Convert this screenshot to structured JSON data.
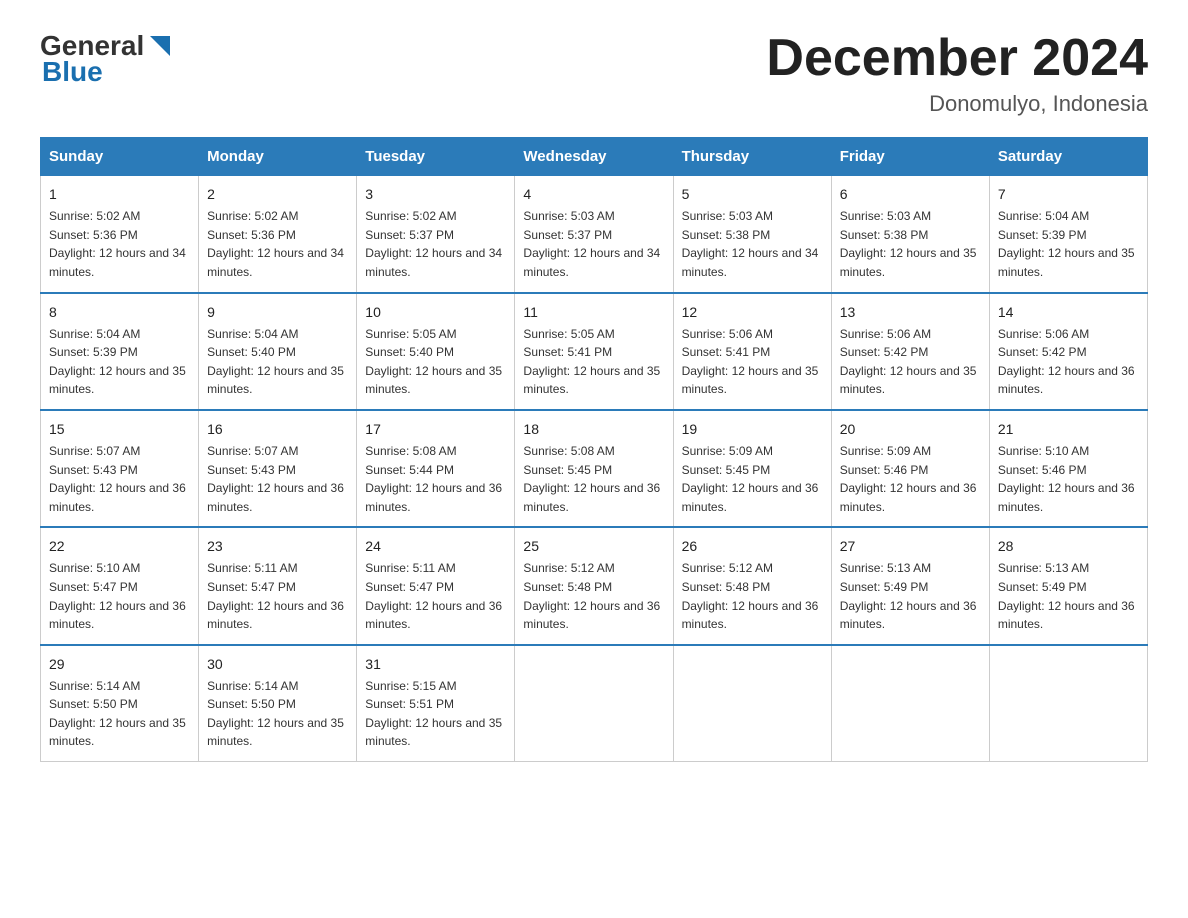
{
  "logo": {
    "general": "General",
    "blue": "Blue",
    "triangle_color": "#1a6faf"
  },
  "title": "December 2024",
  "subtitle": "Donomulyo, Indonesia",
  "days_of_week": [
    "Sunday",
    "Monday",
    "Tuesday",
    "Wednesday",
    "Thursday",
    "Friday",
    "Saturday"
  ],
  "weeks": [
    [
      {
        "num": "1",
        "sunrise": "5:02 AM",
        "sunset": "5:36 PM",
        "daylight": "12 hours and 34 minutes."
      },
      {
        "num": "2",
        "sunrise": "5:02 AM",
        "sunset": "5:36 PM",
        "daylight": "12 hours and 34 minutes."
      },
      {
        "num": "3",
        "sunrise": "5:02 AM",
        "sunset": "5:37 PM",
        "daylight": "12 hours and 34 minutes."
      },
      {
        "num": "4",
        "sunrise": "5:03 AM",
        "sunset": "5:37 PM",
        "daylight": "12 hours and 34 minutes."
      },
      {
        "num": "5",
        "sunrise": "5:03 AM",
        "sunset": "5:38 PM",
        "daylight": "12 hours and 34 minutes."
      },
      {
        "num": "6",
        "sunrise": "5:03 AM",
        "sunset": "5:38 PM",
        "daylight": "12 hours and 35 minutes."
      },
      {
        "num": "7",
        "sunrise": "5:04 AM",
        "sunset": "5:39 PM",
        "daylight": "12 hours and 35 minutes."
      }
    ],
    [
      {
        "num": "8",
        "sunrise": "5:04 AM",
        "sunset": "5:39 PM",
        "daylight": "12 hours and 35 minutes."
      },
      {
        "num": "9",
        "sunrise": "5:04 AM",
        "sunset": "5:40 PM",
        "daylight": "12 hours and 35 minutes."
      },
      {
        "num": "10",
        "sunrise": "5:05 AM",
        "sunset": "5:40 PM",
        "daylight": "12 hours and 35 minutes."
      },
      {
        "num": "11",
        "sunrise": "5:05 AM",
        "sunset": "5:41 PM",
        "daylight": "12 hours and 35 minutes."
      },
      {
        "num": "12",
        "sunrise": "5:06 AM",
        "sunset": "5:41 PM",
        "daylight": "12 hours and 35 minutes."
      },
      {
        "num": "13",
        "sunrise": "5:06 AM",
        "sunset": "5:42 PM",
        "daylight": "12 hours and 35 minutes."
      },
      {
        "num": "14",
        "sunrise": "5:06 AM",
        "sunset": "5:42 PM",
        "daylight": "12 hours and 36 minutes."
      }
    ],
    [
      {
        "num": "15",
        "sunrise": "5:07 AM",
        "sunset": "5:43 PM",
        "daylight": "12 hours and 36 minutes."
      },
      {
        "num": "16",
        "sunrise": "5:07 AM",
        "sunset": "5:43 PM",
        "daylight": "12 hours and 36 minutes."
      },
      {
        "num": "17",
        "sunrise": "5:08 AM",
        "sunset": "5:44 PM",
        "daylight": "12 hours and 36 minutes."
      },
      {
        "num": "18",
        "sunrise": "5:08 AM",
        "sunset": "5:45 PM",
        "daylight": "12 hours and 36 minutes."
      },
      {
        "num": "19",
        "sunrise": "5:09 AM",
        "sunset": "5:45 PM",
        "daylight": "12 hours and 36 minutes."
      },
      {
        "num": "20",
        "sunrise": "5:09 AM",
        "sunset": "5:46 PM",
        "daylight": "12 hours and 36 minutes."
      },
      {
        "num": "21",
        "sunrise": "5:10 AM",
        "sunset": "5:46 PM",
        "daylight": "12 hours and 36 minutes."
      }
    ],
    [
      {
        "num": "22",
        "sunrise": "5:10 AM",
        "sunset": "5:47 PM",
        "daylight": "12 hours and 36 minutes."
      },
      {
        "num": "23",
        "sunrise": "5:11 AM",
        "sunset": "5:47 PM",
        "daylight": "12 hours and 36 minutes."
      },
      {
        "num": "24",
        "sunrise": "5:11 AM",
        "sunset": "5:47 PM",
        "daylight": "12 hours and 36 minutes."
      },
      {
        "num": "25",
        "sunrise": "5:12 AM",
        "sunset": "5:48 PM",
        "daylight": "12 hours and 36 minutes."
      },
      {
        "num": "26",
        "sunrise": "5:12 AM",
        "sunset": "5:48 PM",
        "daylight": "12 hours and 36 minutes."
      },
      {
        "num": "27",
        "sunrise": "5:13 AM",
        "sunset": "5:49 PM",
        "daylight": "12 hours and 36 minutes."
      },
      {
        "num": "28",
        "sunrise": "5:13 AM",
        "sunset": "5:49 PM",
        "daylight": "12 hours and 36 minutes."
      }
    ],
    [
      {
        "num": "29",
        "sunrise": "5:14 AM",
        "sunset": "5:50 PM",
        "daylight": "12 hours and 35 minutes."
      },
      {
        "num": "30",
        "sunrise": "5:14 AM",
        "sunset": "5:50 PM",
        "daylight": "12 hours and 35 minutes."
      },
      {
        "num": "31",
        "sunrise": "5:15 AM",
        "sunset": "5:51 PM",
        "daylight": "12 hours and 35 minutes."
      },
      null,
      null,
      null,
      null
    ]
  ]
}
